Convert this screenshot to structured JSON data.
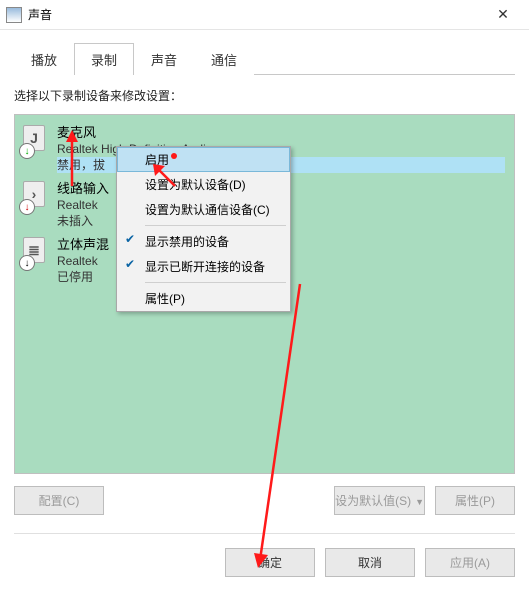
{
  "window": {
    "title": "声音"
  },
  "tabs": {
    "play": "播放",
    "record": "录制",
    "sound": "声音",
    "comm": "通信"
  },
  "instruction": "选择以下录制设备来修改设置：",
  "devices": [
    {
      "name": "麦克风",
      "sub": "Realtek High Definition Audio",
      "status": "禁用，拔",
      "badge": "green"
    },
    {
      "name": "线路输入",
      "sub": "Realtek",
      "status": "未插入",
      "badge": "red"
    },
    {
      "name": "立体声混",
      "sub": "Realtek",
      "status": "已停用",
      "badge": "black"
    }
  ],
  "context_menu": {
    "enable": "启用",
    "set_default": "设置为默认设备(D)",
    "set_default_comm": "设置为默认通信设备(C)",
    "show_disabled": "显示禁用的设备",
    "show_disconnected": "显示已断开连接的设备",
    "properties": "属性(P)"
  },
  "bottom1": {
    "configure": "配置(C)",
    "set_default": "设为默认值(S)",
    "properties": "属性(P)"
  },
  "bottom2": {
    "ok": "确定",
    "cancel": "取消",
    "apply": "应用(A)"
  }
}
